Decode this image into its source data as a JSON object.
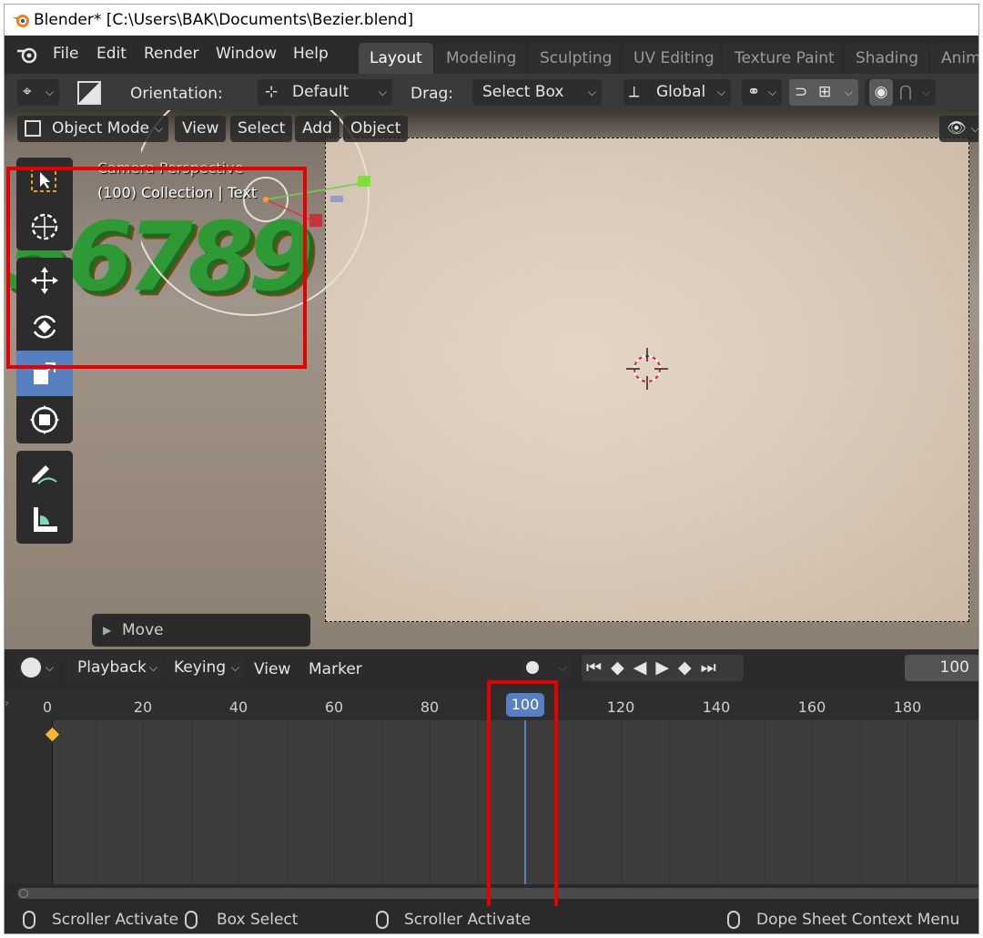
{
  "window": {
    "title": "Blender* [C:\\Users\\BAK\\Documents\\Bezier.blend]"
  },
  "menu": {
    "items": [
      "File",
      "Edit",
      "Render",
      "Window",
      "Help"
    ]
  },
  "workspaces": {
    "tabs": [
      "Layout",
      "Modeling",
      "Sculpting",
      "UV Editing",
      "Texture Paint",
      "Shading",
      "Anim"
    ],
    "active": "Layout"
  },
  "tool_header": {
    "orientation_label": "Orientation:",
    "orientation_value": "Default",
    "drag_label": "Drag:",
    "drag_value": "Select Box",
    "transform_orientation": "Global"
  },
  "viewport_header": {
    "mode": "Object Mode",
    "view": "View",
    "select": "Select",
    "add": "Add",
    "object": "Object"
  },
  "viewport": {
    "info_line1": "Camera Perspective",
    "info_line2": "(100) Collection | Text",
    "text_object": "56789",
    "last_operator": "Move"
  },
  "toolbar": {
    "tools": [
      "select-box",
      "cursor",
      "move",
      "rotate",
      "scale",
      "transform",
      "annotate",
      "measure"
    ],
    "active": "scale"
  },
  "timeline": {
    "header": {
      "playback": "Playback",
      "keying": "Keying",
      "view": "View",
      "marker": "Marker",
      "current_frame": "100"
    },
    "ruler_ticks": [
      "0",
      "20",
      "40",
      "60",
      "80",
      "100",
      "120",
      "140",
      "160",
      "180"
    ],
    "playhead": "100",
    "keyframe": "0"
  },
  "statusbar": {
    "left": "Scroller Activate",
    "box_select": "Box Select",
    "middle": "Scroller Activate",
    "right": "Dope Sheet Context Menu"
  },
  "colors": {
    "accent": "#5680c2",
    "highlight_box": "#e80000",
    "keyframe": "#f5b731",
    "text_object": "#2f9a35"
  }
}
